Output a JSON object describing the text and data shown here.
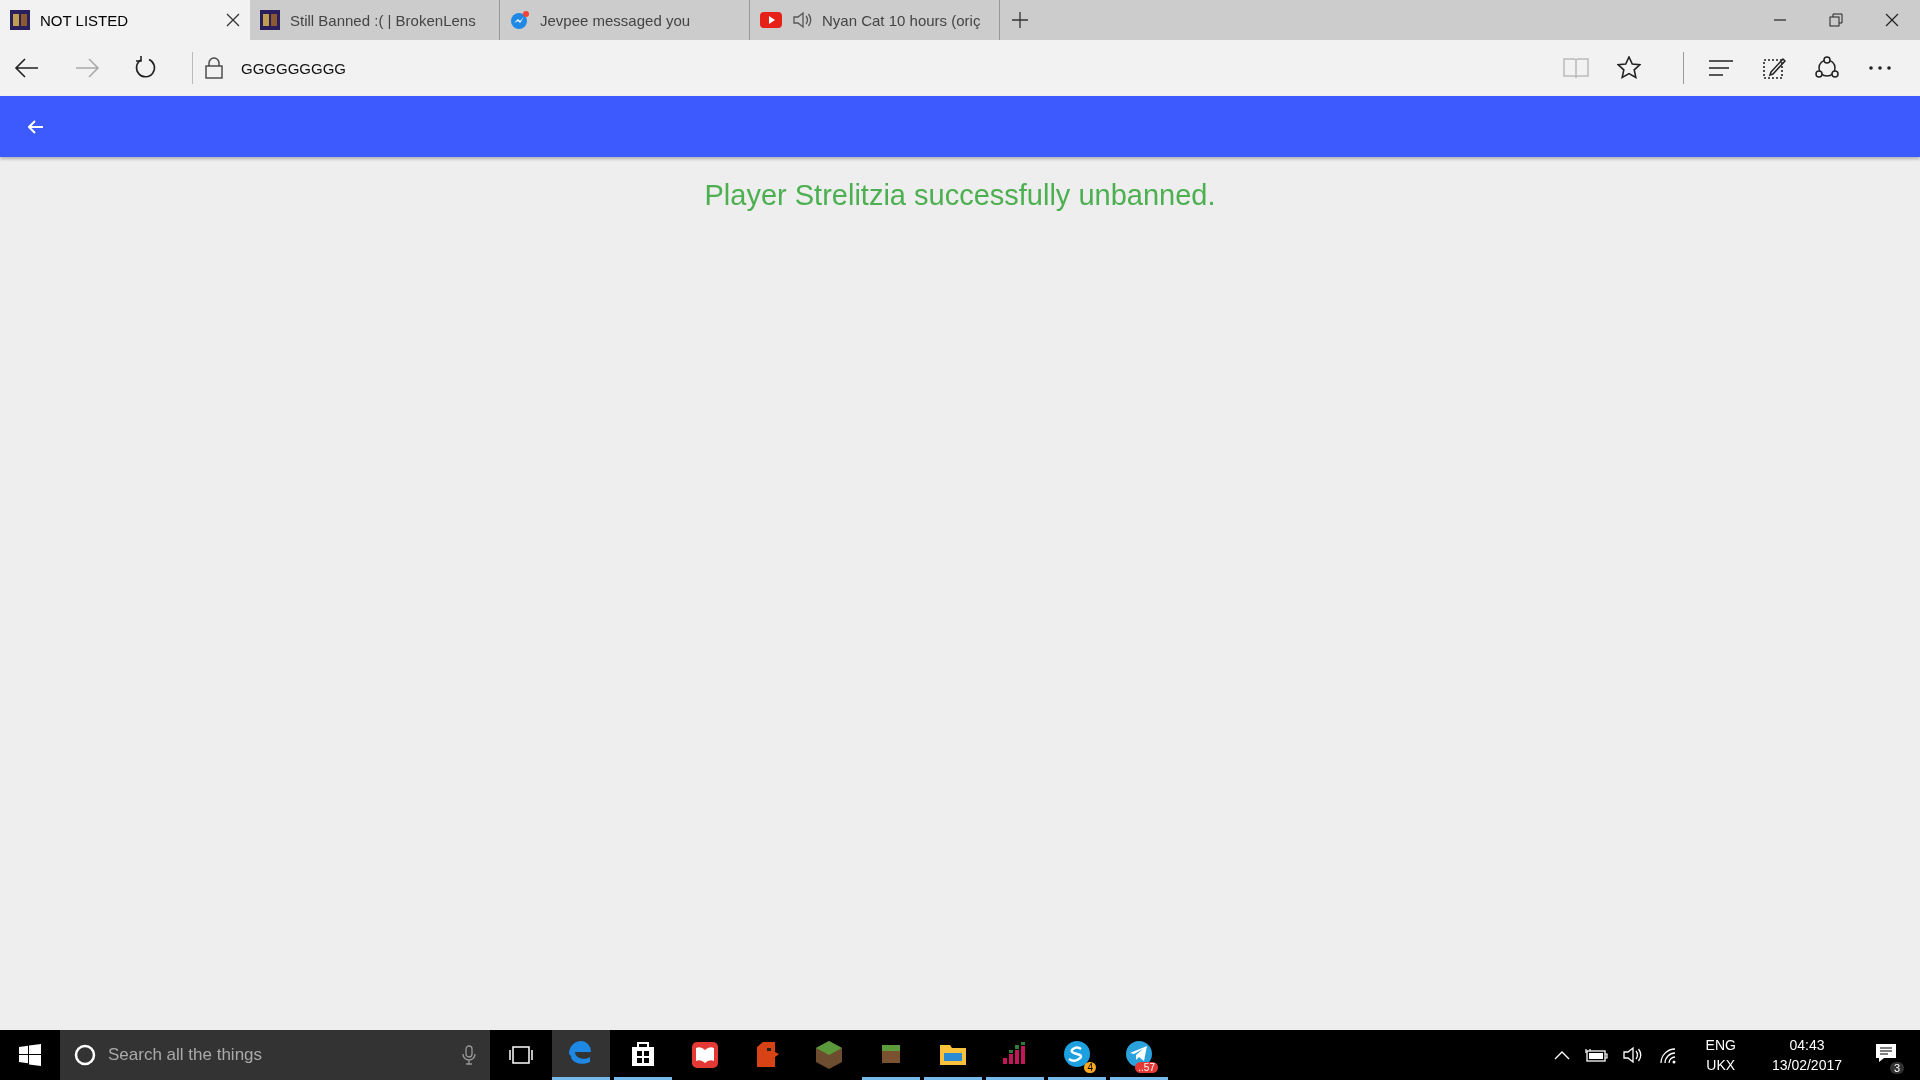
{
  "tabs": [
    {
      "title": "NOT LISTED",
      "selected": true,
      "kind": "site",
      "audio": false
    },
    {
      "title": "Still Banned :( | BrokenLens",
      "selected": false,
      "kind": "site",
      "audio": false
    },
    {
      "title": "Jevpee messaged you",
      "selected": false,
      "kind": "messenger",
      "audio": false
    },
    {
      "title": "Nyan Cat 10 hours (oriç",
      "selected": false,
      "kind": "video",
      "audio": true
    }
  ],
  "address_bar": {
    "url": "GGGGGGGGG"
  },
  "page": {
    "message": "Player Strelitzia successfully unbanned."
  },
  "taskbar": {
    "search": {
      "placeholder": "Search all the things"
    },
    "apps": [
      {
        "kind": "edge",
        "running": true,
        "selected": true
      },
      {
        "kind": "store",
        "running": true,
        "selected": false
      },
      {
        "kind": "book",
        "running": false,
        "selected": false
      },
      {
        "kind": "face",
        "running": false,
        "selected": false
      },
      {
        "kind": "grassblock",
        "running": false,
        "selected": false
      },
      {
        "kind": "dirtblock",
        "running": true,
        "selected": false
      },
      {
        "kind": "folder",
        "running": true,
        "selected": false
      },
      {
        "kind": "equalizer",
        "running": true,
        "selected": false
      },
      {
        "kind": "skype",
        "running": true,
        "selected": false,
        "badge": "4"
      },
      {
        "kind": "telegram",
        "running": true,
        "selected": false,
        "badge": "..57"
      }
    ],
    "language": {
      "input": "ENG",
      "layout": "UKX"
    },
    "clock": {
      "time": "04:43",
      "date": "13/02/2017"
    },
    "notifications": {
      "count": "3"
    }
  }
}
